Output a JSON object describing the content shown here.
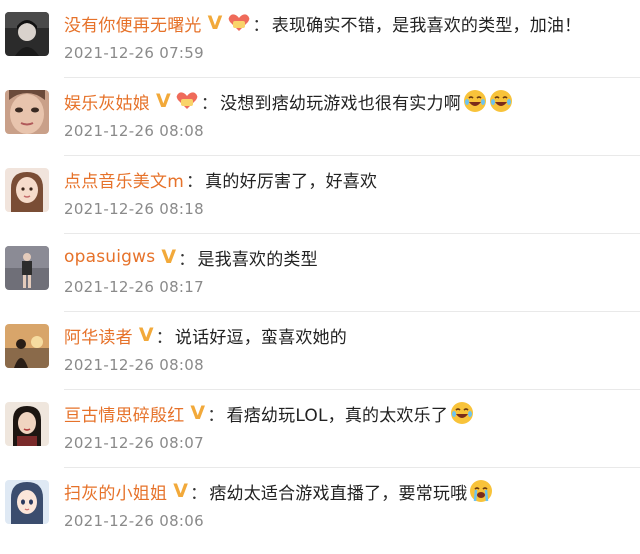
{
  "comments": [
    {
      "username": "没有你便再无曙光",
      "verified_mark": "V",
      "has_fan_badge": true,
      "colon": "：",
      "text": "表现确实不错，是我喜欢的类型，加油！",
      "emojis": [],
      "timestamp": "2021-12-26 07:59",
      "avatar_icon": "avatar-dark-portrait-icon"
    },
    {
      "username": "娱乐灰姑娘",
      "verified_mark": "V",
      "has_fan_badge": true,
      "colon": "：",
      "text": "没想到痞幼玩游戏也很有实力啊",
      "emojis": [
        "laughing-tears-emoji-icon",
        "laughing-tears-emoji-icon"
      ],
      "timestamp": "2021-12-26 08:08",
      "avatar_icon": "avatar-face-closeup-icon"
    },
    {
      "username": "点点音乐美文m",
      "verified_mark": "",
      "has_fan_badge": false,
      "colon": "：",
      "text": "真的好厉害了，好喜欢",
      "emojis": [],
      "timestamp": "2021-12-26 08:18",
      "avatar_icon": "avatar-cartoon-girl-icon"
    },
    {
      "username": "opasuigws",
      "verified_mark": "V",
      "has_fan_badge": false,
      "colon": "：",
      "text": "是我喜欢的类型",
      "emojis": [],
      "timestamp": "2021-12-26 08:17",
      "avatar_icon": "avatar-full-body-photo-icon"
    },
    {
      "username": "阿华读者",
      "verified_mark": "V",
      "has_fan_badge": false,
      "colon": "：",
      "text": "说话好逗，蛮喜欢她的",
      "emojis": [],
      "timestamp": "2021-12-26 08:08",
      "avatar_icon": "avatar-sunset-silhouette-icon"
    },
    {
      "username": "亘古情思碎殷红",
      "verified_mark": "V",
      "has_fan_badge": false,
      "colon": "：",
      "text": "看痞幼玩LOL，真的太欢乐了",
      "emojis": [
        "laughing-tears-emoji-icon"
      ],
      "timestamp": "2021-12-26 08:07",
      "avatar_icon": "avatar-woman-portrait-icon"
    },
    {
      "username": "扫灰的小姐姐",
      "verified_mark": "V",
      "has_fan_badge": false,
      "colon": "：",
      "text": "痞幼太适合游戏直播了，要常玩哦",
      "emojis": [
        "crying-emoji-icon"
      ],
      "timestamp": "2021-12-26 08:06",
      "avatar_icon": "avatar-anime-girl-icon"
    }
  ],
  "colors": {
    "username": "#e6722a",
    "verified": "#f2a93a",
    "text": "#222222",
    "timestamp": "#8a8a8a",
    "divider": "#e9e9e9"
  }
}
